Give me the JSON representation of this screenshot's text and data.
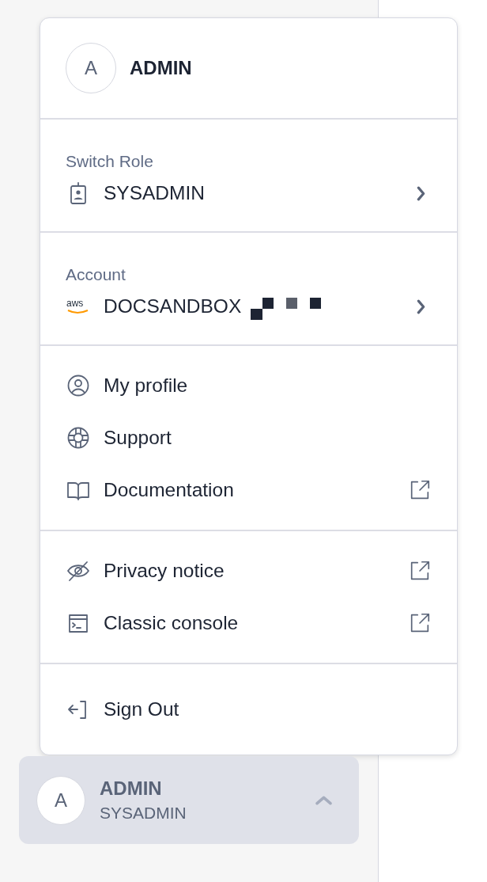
{
  "menu": {
    "header": {
      "initial": "A",
      "name": "ADMIN"
    },
    "sections": [
      {
        "label": "Switch Role",
        "items": [
          {
            "label": "SYSADMIN",
            "kind": "submenu"
          }
        ]
      },
      {
        "label": "Account",
        "items": [
          {
            "label": "DOCSANDBOX",
            "kind": "submenu",
            "logo_text": "aws",
            "redacted": true
          }
        ]
      },
      {
        "items": [
          {
            "label": "My profile",
            "kind": "plain"
          },
          {
            "label": "Support",
            "kind": "plain"
          },
          {
            "label": "Documentation",
            "kind": "external"
          }
        ]
      },
      {
        "items": [
          {
            "label": "Privacy notice",
            "kind": "external"
          },
          {
            "label": "Classic console",
            "kind": "external"
          }
        ]
      },
      {
        "items": [
          {
            "label": "Sign Out",
            "kind": "plain"
          }
        ]
      }
    ]
  },
  "user_button": {
    "initial": "A",
    "name": "ADMIN",
    "role": "SYSADMIN",
    "expanded": true
  }
}
